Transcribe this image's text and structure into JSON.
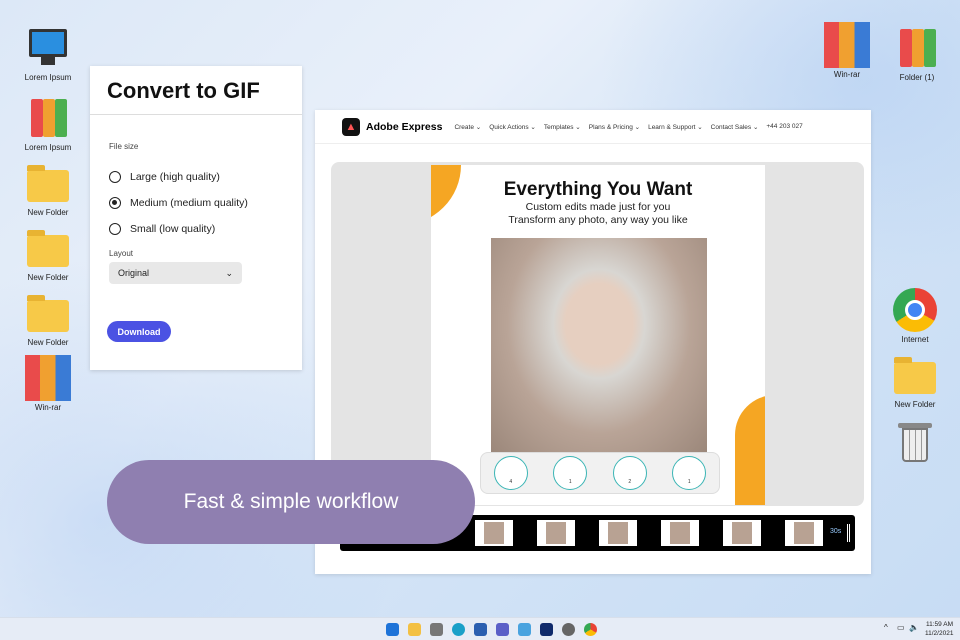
{
  "desktop": {
    "left_icons": [
      {
        "label": "Lorem Ipsum",
        "icon": "computer-icon"
      },
      {
        "label": "Lorem Ipsum",
        "icon": "binders-icon"
      },
      {
        "label": "New Folder",
        "icon": "folder-icon"
      },
      {
        "label": "New Folder",
        "icon": "folder-icon"
      },
      {
        "label": "New Folder",
        "icon": "folder-icon"
      },
      {
        "label": "Win-rar",
        "icon": "winrar-icon"
      }
    ],
    "right_icons": [
      {
        "label": "Win-rar",
        "icon": "winrar-icon"
      },
      {
        "label": "Folder (1)",
        "icon": "binders-icon"
      },
      {
        "label": "Internet",
        "icon": "chrome-icon"
      },
      {
        "label": "New Folder",
        "icon": "folder-icon"
      },
      {
        "label": "",
        "icon": "trash-icon"
      }
    ]
  },
  "panel": {
    "title": "Convert to GIF",
    "file_size_label": "File size",
    "options": [
      {
        "label": "Large (high quality)",
        "selected": false
      },
      {
        "label": "Medium (medium quality)",
        "selected": true
      },
      {
        "label": "Small (low quality)",
        "selected": false
      }
    ],
    "layout_label": "Layout",
    "layout_value": "Original",
    "download": "Download"
  },
  "browser": {
    "brand": "Adobe Express",
    "menu": [
      "Create ⌄",
      "Quick Actions ⌄",
      "Templates ⌄",
      "Plans & Pricing ⌄",
      "Learn & Support ⌄",
      "Contact Sales ⌄",
      "+44 203 027"
    ],
    "poster": {
      "title": "Everything You Want",
      "line1": "Custom edits made just for you",
      "line2": "Transform any photo, any way you like",
      "tools": [
        "4",
        "1",
        "2",
        "1"
      ]
    },
    "timeline_duration": "30s"
  },
  "banner": "Fast & simple workflow",
  "taskbar": {
    "time": "11:59 AM",
    "date": "11/2/2021",
    "apps": [
      "start",
      "file-explorer",
      "camera",
      "edge",
      "store",
      "teams",
      "paint",
      "app",
      "settings",
      "chrome"
    ]
  }
}
